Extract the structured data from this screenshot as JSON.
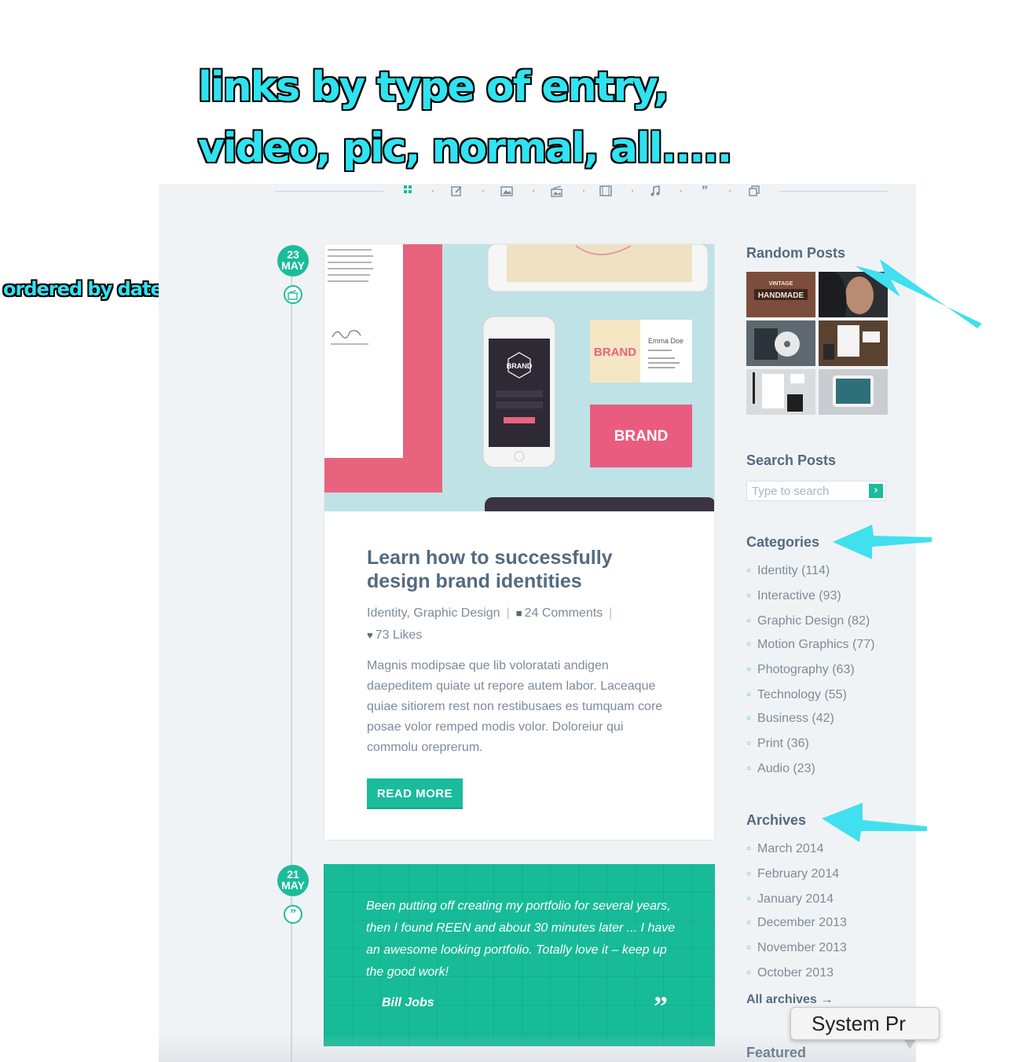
{
  "annotations": {
    "headline_line1": "links by type of entry,",
    "headline_line2": "video, pic, normal, all.....",
    "timeline_note": "ordered by date"
  },
  "filters": [
    {
      "name": "all",
      "icon": "grid-icon"
    },
    {
      "name": "standard",
      "icon": "pencil-icon"
    },
    {
      "name": "image",
      "icon": "image-icon"
    },
    {
      "name": "gallery",
      "icon": "gallery-icon"
    },
    {
      "name": "video",
      "icon": "film-icon"
    },
    {
      "name": "audio",
      "icon": "music-icon"
    },
    {
      "name": "quote",
      "icon": "quote-icon"
    },
    {
      "name": "link",
      "icon": "link-icon"
    }
  ],
  "posts": [
    {
      "day": "23",
      "month": "MAY",
      "type_icon": "gallery-icon",
      "title": "Learn how to successfully design brand identities",
      "categories": "Identity, Graphic Design",
      "comments": "24 Comments",
      "likes": "73 Likes",
      "excerpt": "Magnis modipsae que lib voloratati andigen daepeditem quiate ut repore autem labor. Laceaque quiae sitiorem rest non restibusaes es tumquam core posae volor remped modis volor. Doloreiur qui commolu oreprerum.",
      "read_more": "READ MORE",
      "mockup": {
        "brand_logo": "BRAND",
        "card_name": "Emma Doe",
        "signature": "Emma Doe"
      }
    },
    {
      "day": "21",
      "month": "MAY",
      "type_icon": "quote-icon",
      "quote": "Been putting off creating my portfolio for several years, then I found REEN and about 30 minutes later ... I have an awesome looking portfolio. Totally love it – keep up the good work!",
      "author": "Bill Jobs",
      "quote_mark": "99"
    }
  ],
  "sidebar": {
    "random_posts_title": "Random Posts",
    "random_thumbs": [
      "vintage-handmade",
      "portrait-woman",
      "cd-mockup",
      "stationery-wood",
      "stationery-grey",
      "ipad-mockup"
    ],
    "handmade_text": "HANDMADE",
    "vintage_text": "VINTAGE",
    "search_title": "Search Posts",
    "search_placeholder": "Type to search",
    "categories_title": "Categories",
    "categories": [
      "Identity (114)",
      "Interactive (93)",
      "Graphic Design (82)",
      "Motion Graphics (77)",
      "Photography (63)",
      "Technology (55)",
      "Business (42)",
      "Print (36)",
      "Audio (23)"
    ],
    "archives_title": "Archives",
    "archives": [
      "March 2014",
      "February 2014",
      "January 2014",
      "December 2013",
      "November 2013",
      "October 2013"
    ],
    "all_archives": "All archives →",
    "featured_title": "Featured"
  },
  "tooltip": "System Pr",
  "colors": {
    "accent": "#1abc9c",
    "annotation": "#2fe3f0",
    "heading": "#546a80",
    "body_text": "#7d8b99",
    "page_bg": "#f0f3f6"
  }
}
